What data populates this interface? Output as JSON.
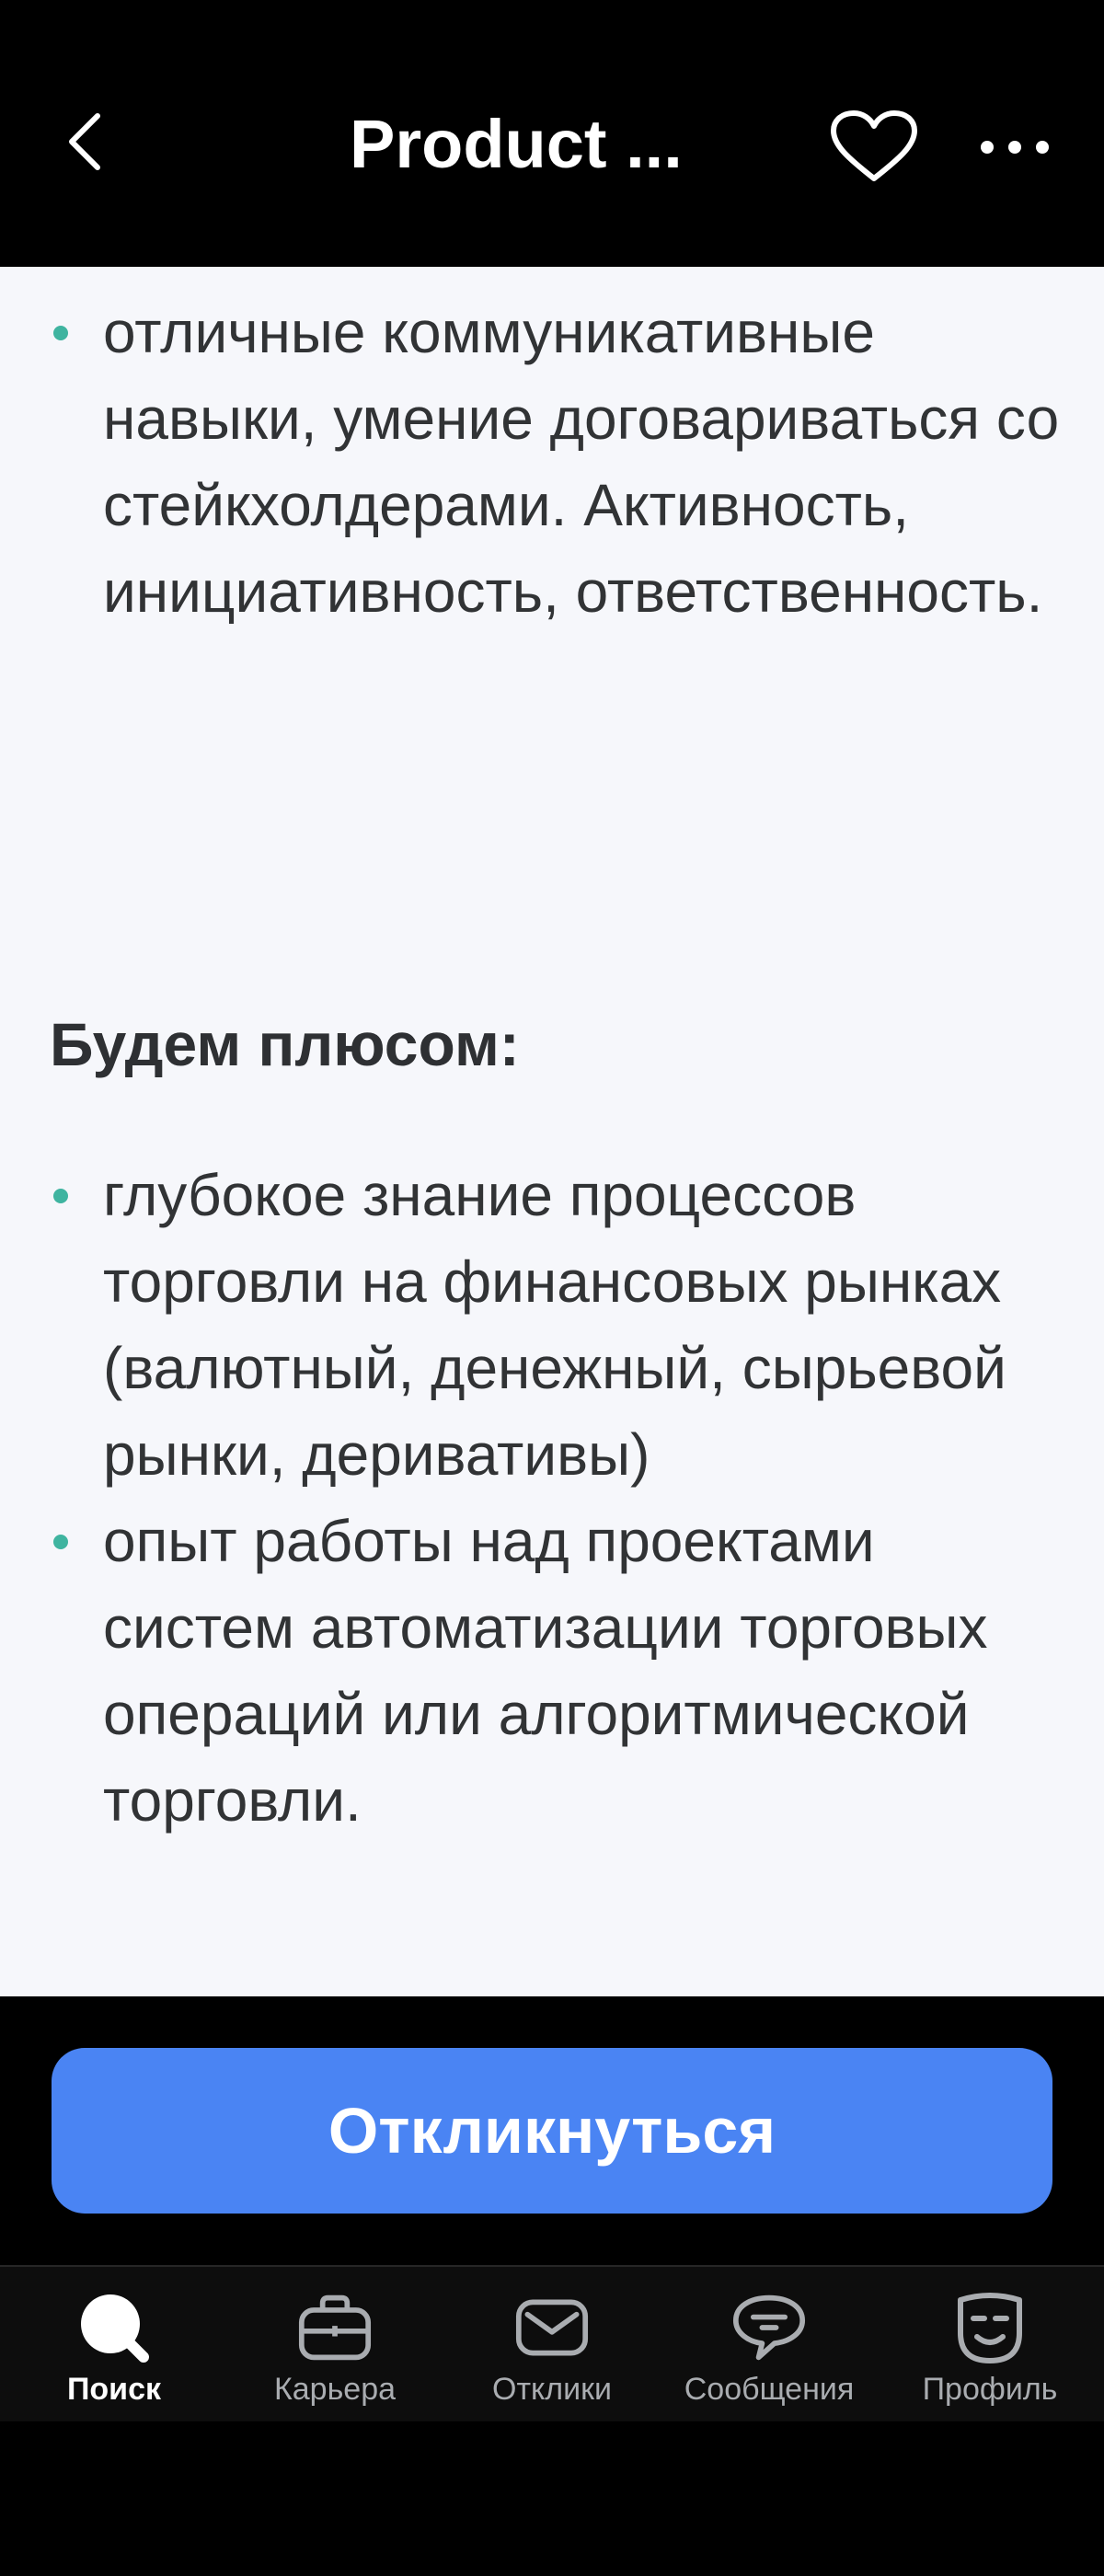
{
  "header": {
    "title": "Product ...",
    "back_icon": "chevron-left-icon",
    "favorite_icon": "heart-outline-icon",
    "more_icon": "more-horizontal-icon"
  },
  "content": {
    "list1": [
      "отличные коммуникативные навыки, умение договариваться со стейкхолдерами. Активность, инициативность, ответственность."
    ],
    "section_title": "Будем плюсом:",
    "list2": [
      "глубокое знание процессов торговли на финансовых рынках (валютный, денежный, сырьевой рынки, деривативы)",
      "опыт работы над проектами систем автоматизации торговых операций или алгоритмической торговли."
    ]
  },
  "footer": {
    "apply_label": "Откликнуться",
    "apply_color": "#4a84f3"
  },
  "nav": {
    "items": [
      {
        "label": "Поиск",
        "icon": "search-icon",
        "active": true
      },
      {
        "label": "Карьера",
        "icon": "briefcase-icon",
        "active": false
      },
      {
        "label": "Отклики",
        "icon": "envelope-icon",
        "active": false
      },
      {
        "label": "Сообщения",
        "icon": "chat-icon",
        "active": false
      },
      {
        "label": "Профиль",
        "icon": "profile-icon",
        "active": false
      }
    ]
  },
  "colors": {
    "bullet": "#3fb4a0",
    "background": "#f6f7fb"
  }
}
